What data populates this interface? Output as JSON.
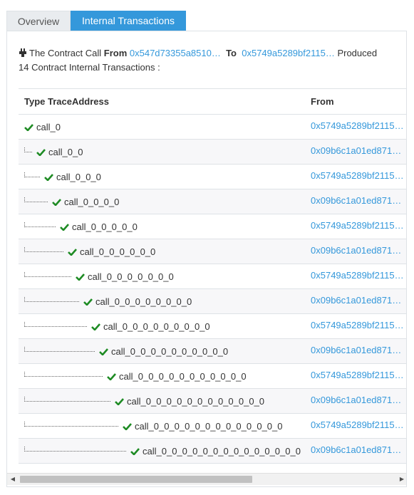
{
  "tabs": [
    {
      "label": "Overview",
      "active": false
    },
    {
      "label": "Internal Transactions",
      "active": true
    }
  ],
  "summary": {
    "icon": "plug-icon",
    "prefix": "The Contract Call ",
    "from_label": "From",
    "from_address": "0x547d73355a8510…",
    "to_label": "To",
    "to_address": "0x5749a5289bf2115…",
    "suffix_1": " Produced",
    "line2": "14 Contract Internal Transactions :"
  },
  "table": {
    "headers": {
      "type_trace": "Type TraceAddress",
      "from": "From"
    },
    "rows": [
      {
        "trace": "call_0",
        "from": "0x5749a5289bf2115…",
        "depth": 0
      },
      {
        "trace": "call_0_0",
        "from": "0x09b6c1a01ed871…",
        "depth": 1
      },
      {
        "trace": "call_0_0_0",
        "from": "0x5749a5289bf2115…",
        "depth": 2
      },
      {
        "trace": "call_0_0_0_0",
        "from": "0x09b6c1a01ed871…",
        "depth": 3
      },
      {
        "trace": "call_0_0_0_0_0",
        "from": "0x5749a5289bf2115…",
        "depth": 4
      },
      {
        "trace": "call_0_0_0_0_0_0",
        "from": "0x09b6c1a01ed871…",
        "depth": 5
      },
      {
        "trace": "call_0_0_0_0_0_0_0",
        "from": "0x5749a5289bf2115…",
        "depth": 6
      },
      {
        "trace": "call_0_0_0_0_0_0_0_0",
        "from": "0x09b6c1a01ed871…",
        "depth": 7
      },
      {
        "trace": "call_0_0_0_0_0_0_0_0_0",
        "from": "0x5749a5289bf2115…",
        "depth": 8
      },
      {
        "trace": "call_0_0_0_0_0_0_0_0_0_0",
        "from": "0x09b6c1a01ed871…",
        "depth": 9
      },
      {
        "trace": "call_0_0_0_0_0_0_0_0_0_0_0",
        "from": "0x5749a5289bf2115…",
        "depth": 10
      },
      {
        "trace": "call_0_0_0_0_0_0_0_0_0_0_0_0",
        "from": "0x09b6c1a01ed871…",
        "depth": 11
      },
      {
        "trace": "call_0_0_0_0_0_0_0_0_0_0_0_0_0",
        "from": "0x5749a5289bf2115…",
        "depth": 12
      },
      {
        "trace": "call_0_0_0_0_0_0_0_0_0_0_0_0_0_0",
        "from": "0x09b6c1a01ed871…",
        "depth": 13
      }
    ],
    "status_icon": "check-icon"
  },
  "colors": {
    "accent": "#3498db",
    "check": "#1e8b24",
    "tab_inactive_bg": "#e9ecef"
  }
}
